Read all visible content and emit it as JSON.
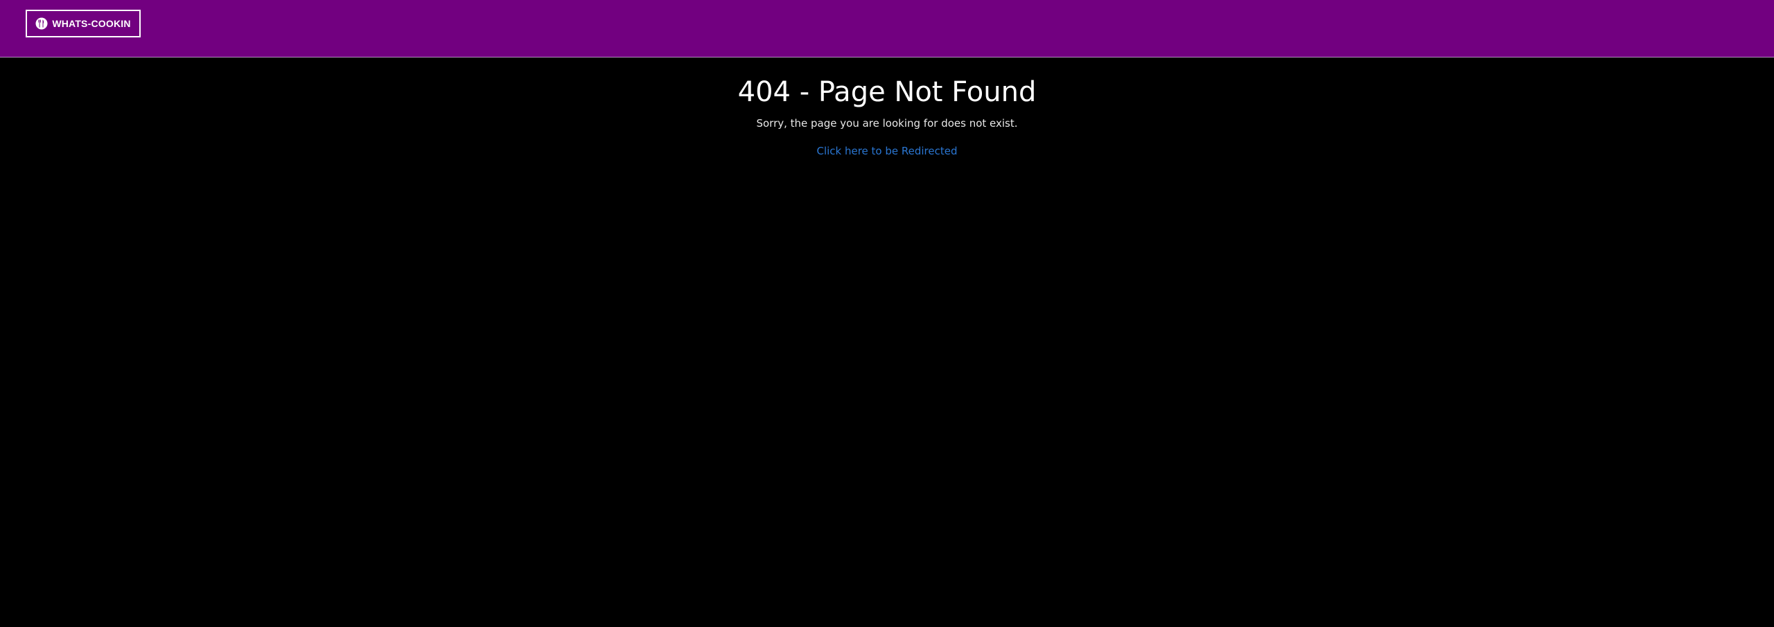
{
  "navbar": {
    "brand_label": "WHATS-COOKIN",
    "brand_icon": "fork-knife-icon",
    "background_color": "#720080"
  },
  "main": {
    "title": "404 - Page Not Found",
    "message": "Sorry, the page you are looking for does not exist.",
    "redirect_link": "Click here to be Redirected",
    "link_color": "#2a76d2"
  }
}
